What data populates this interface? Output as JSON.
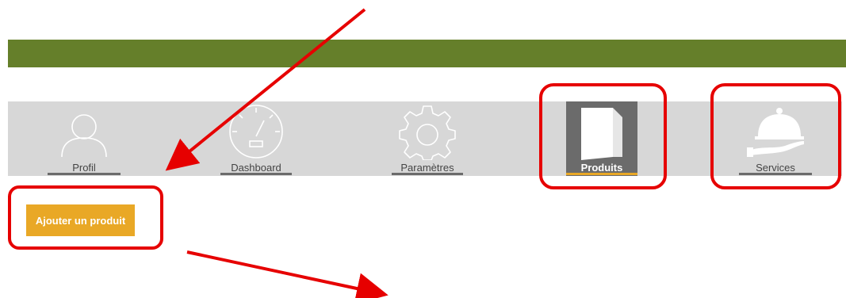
{
  "nav": {
    "items": [
      {
        "label": "Profil",
        "icon": "user-icon"
      },
      {
        "label": "Dashboard",
        "icon": "speedometer-icon"
      },
      {
        "label": "Paramètres",
        "icon": "gear-icon"
      },
      {
        "label": "Produits",
        "icon": "shopping-bag-icon",
        "active": true
      },
      {
        "label": "Services",
        "icon": "cloche-service-icon"
      }
    ]
  },
  "actions": {
    "add_product_label": "Ajouter un produit"
  },
  "colors": {
    "header_green": "#657f2a",
    "nav_gray": "#d7d7d7",
    "active_dark": "#6b6b6b",
    "accent_orange": "#e9a826",
    "annotation_red": "#e60000"
  }
}
